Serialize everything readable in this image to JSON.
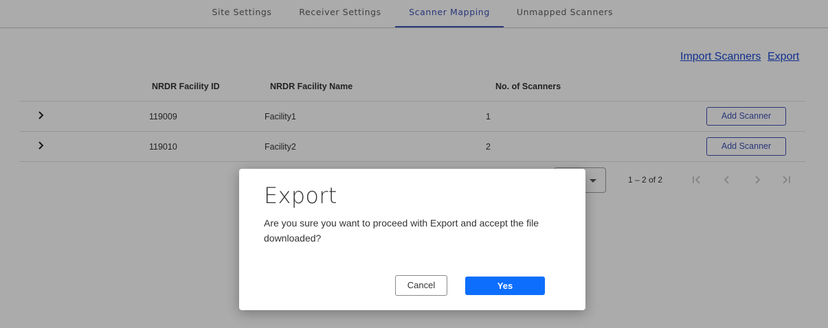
{
  "tabs": [
    {
      "label": "Site Settings",
      "active": false
    },
    {
      "label": "Receiver Settings",
      "active": false
    },
    {
      "label": "Scanner Mapping",
      "active": true
    },
    {
      "label": "Unmapped Scanners",
      "active": false
    }
  ],
  "actions": {
    "import_label": "Import Scanners",
    "export_label": "Export"
  },
  "table": {
    "headers": {
      "facility_id": "NRDR Facility ID",
      "facility_name": "NRDR Facility Name",
      "num_scanners": "No. of Scanners"
    },
    "rows": [
      {
        "facility_id": "119009",
        "facility_name": "Facility1",
        "num_scanners": "1",
        "action_label": "Add Scanner"
      },
      {
        "facility_id": "119010",
        "facility_name": "Facility2",
        "num_scanners": "2",
        "action_label": "Add Scanner"
      }
    ]
  },
  "paginator": {
    "range_label": "1 – 2 of 2"
  },
  "dialog": {
    "title": "Export",
    "message": "Are you sure you want to proceed with Export and accept the file downloaded?",
    "cancel_label": "Cancel",
    "confirm_label": "Yes"
  },
  "colors": {
    "accent": "#3f51b5",
    "link": "#1a47d6",
    "primary_button": "#0d6efd",
    "overlay": "rgba(0,0,0,0.33)"
  }
}
